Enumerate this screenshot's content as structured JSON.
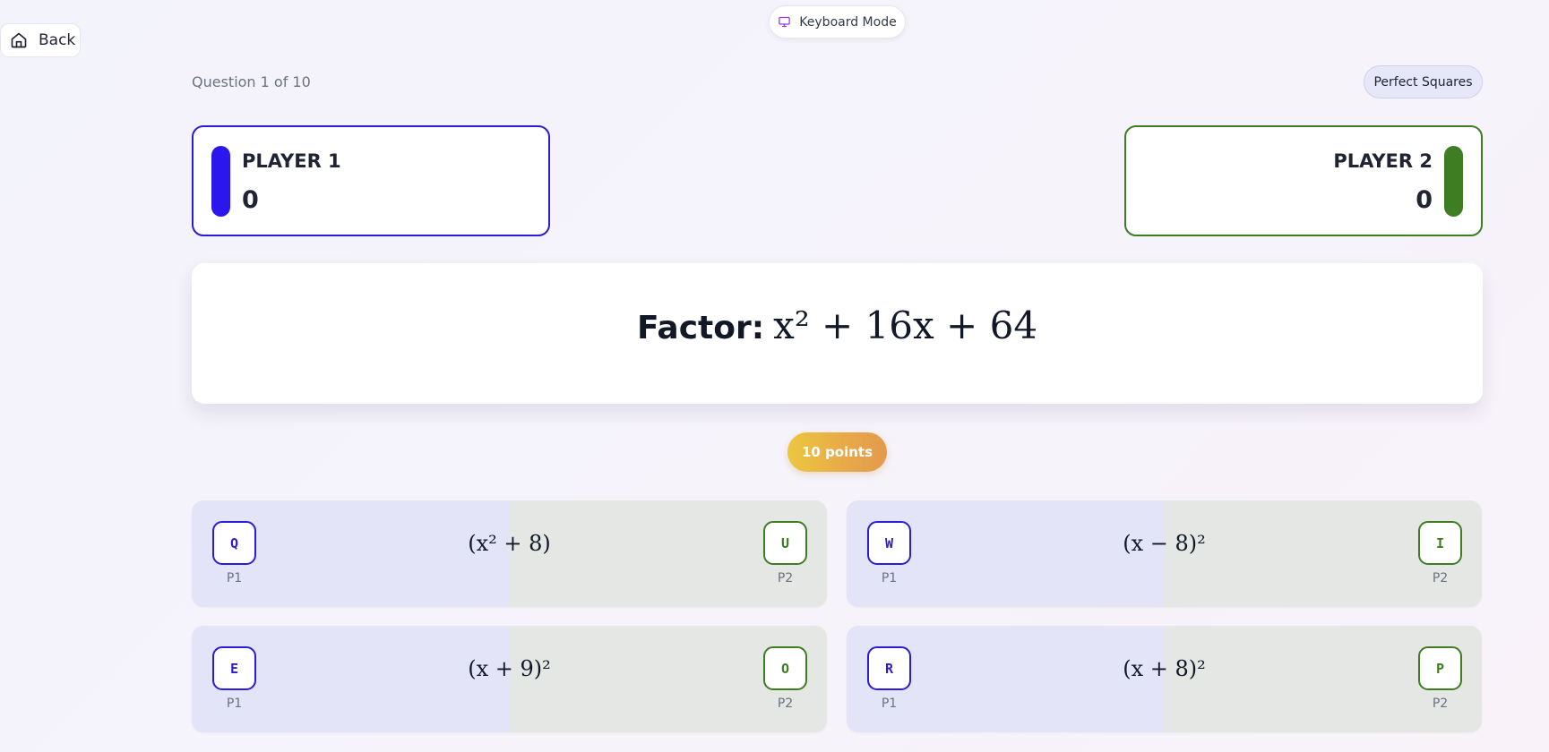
{
  "nav": {
    "back_label": "Back",
    "keyboard_mode_label": "Keyboard Mode"
  },
  "header": {
    "question_counter": "Question 1 of 10",
    "category": "Perfect Squares"
  },
  "players": [
    {
      "name": "PLAYER 1",
      "score": "0",
      "color": "#2b17ee"
    },
    {
      "name": "PLAYER 2",
      "score": "0",
      "color": "#3f7d22"
    }
  ],
  "question": {
    "label": "Factor:",
    "expression": "x² + 16x + 64"
  },
  "points_label": "10 points",
  "answers": [
    {
      "p1_key": "Q",
      "p2_key": "U",
      "p1_label": "P1",
      "p2_label": "P2",
      "text": "(x² + 8)"
    },
    {
      "p1_key": "W",
      "p2_key": "I",
      "p1_label": "P1",
      "p2_label": "P2",
      "text": "(x − 8)²"
    },
    {
      "p1_key": "E",
      "p2_key": "O",
      "p1_label": "P1",
      "p2_label": "P2",
      "text": "(x + 9)²"
    },
    {
      "p1_key": "R",
      "p2_key": "P",
      "p1_label": "P1",
      "p2_label": "P2",
      "text": "(x + 8)²"
    }
  ],
  "icons": {
    "back": "home-icon",
    "keyboard_mode": "monitor-icon"
  }
}
